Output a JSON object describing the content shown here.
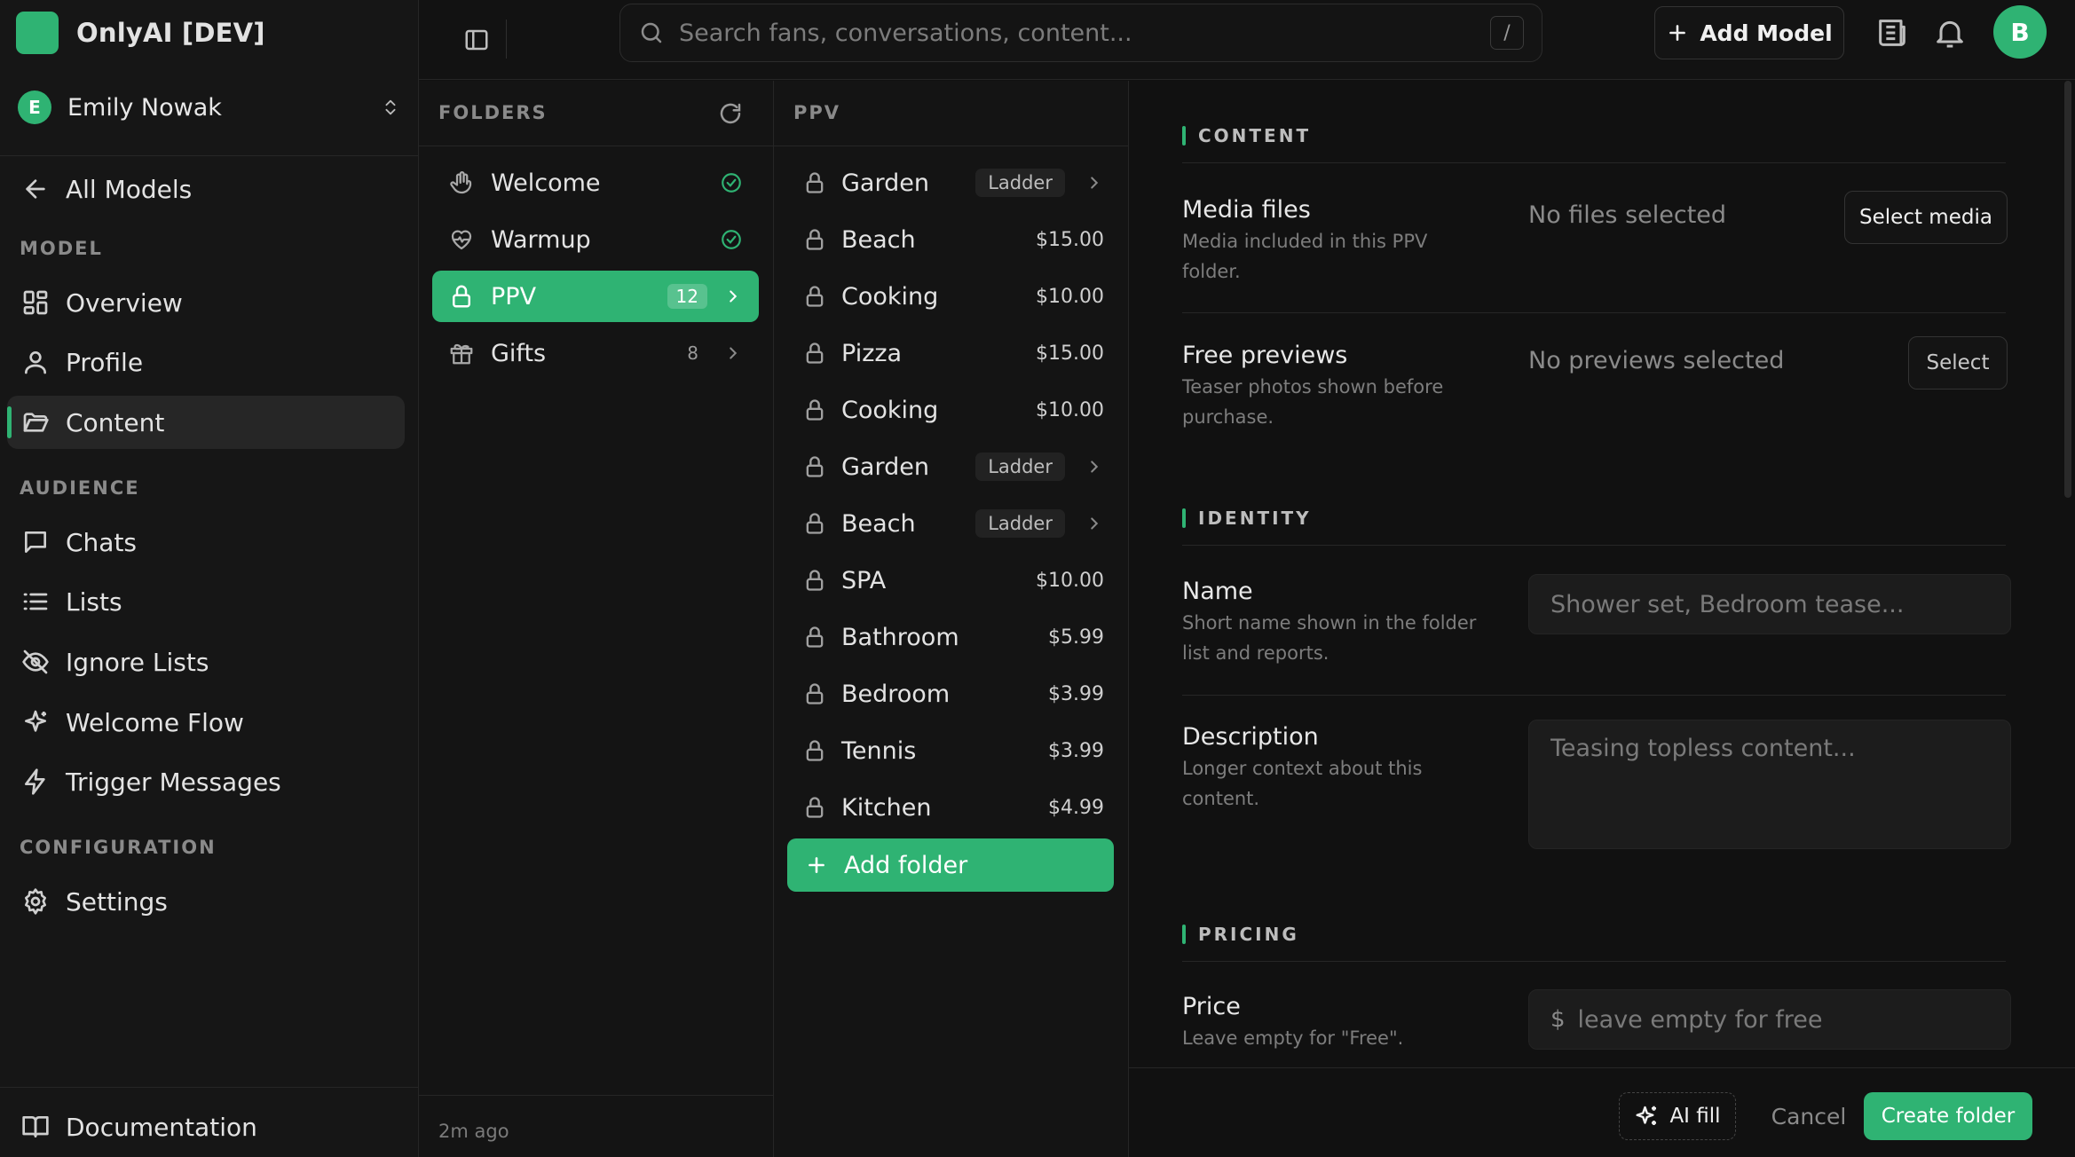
{
  "app": {
    "title": "OnlyAI [DEV]"
  },
  "account": {
    "initial": "E",
    "name": "Emily Nowak"
  },
  "nav": {
    "back_label": "All Models",
    "sections": {
      "model": "MODEL",
      "audience": "AUDIENCE",
      "configuration": "CONFIGURATION"
    },
    "items": {
      "overview": "Overview",
      "profile": "Profile",
      "content": "Content",
      "chats": "Chats",
      "lists": "Lists",
      "ignore_lists": "Ignore Lists",
      "welcome_flow": "Welcome Flow",
      "trigger_messages": "Trigger Messages",
      "settings": "Settings"
    },
    "active": "content",
    "documentation": "Documentation"
  },
  "topbar": {
    "search_placeholder": "Search fans, conversations, content...",
    "search_shortcut": "/",
    "add_model_label": "Add Model",
    "avatar_initial": "B"
  },
  "folders": {
    "header": "FOLDERS",
    "items": [
      {
        "label": "Welcome",
        "status": "done"
      },
      {
        "label": "Warmup",
        "status": "done"
      },
      {
        "label": "PPV",
        "count": "12",
        "active": true
      },
      {
        "label": "Gifts",
        "count": "8"
      }
    ],
    "updated": "2m ago"
  },
  "ppv": {
    "header": "PPV",
    "items": [
      {
        "label": "Garden",
        "tag": "Ladder"
      },
      {
        "label": "Beach",
        "price": "$15.00"
      },
      {
        "label": "Cooking",
        "price": "$10.00"
      },
      {
        "label": "Pizza",
        "price": "$15.00"
      },
      {
        "label": "Cooking",
        "price": "$10.00"
      },
      {
        "label": "Garden",
        "tag": "Ladder"
      },
      {
        "label": "Beach",
        "tag": "Ladder"
      },
      {
        "label": "SPA",
        "price": "$10.00"
      },
      {
        "label": "Bathroom",
        "price": "$5.99"
      },
      {
        "label": "Bedroom",
        "price": "$3.99"
      },
      {
        "label": "Tennis",
        "price": "$3.99"
      },
      {
        "label": "Kitchen",
        "price": "$4.99"
      }
    ],
    "add_label": "Add folder"
  },
  "details": {
    "content": {
      "title": "CONTENT",
      "media": {
        "label": "Media files",
        "help": "Media included in this PPV folder.",
        "value": "No files selected",
        "button": "Select media"
      },
      "previews": {
        "label": "Free previews",
        "help": "Teaser photos shown before purchase.",
        "value": "No previews selected",
        "button": "Select"
      }
    },
    "identity": {
      "title": "IDENTITY",
      "name": {
        "label": "Name",
        "help": "Short name shown in the folder list and reports.",
        "placeholder": "Shower set, Bedroom tease..."
      },
      "description": {
        "label": "Description",
        "help": "Longer context about this content.",
        "placeholder": "Teasing topless content..."
      }
    },
    "pricing": {
      "title": "PRICING",
      "price": {
        "label": "Price",
        "help": "Leave empty for \"Free\".",
        "currency": "$",
        "placeholder": "leave empty for free"
      }
    }
  },
  "footer": {
    "ai_fill": "AI fill",
    "cancel": "Cancel",
    "create": "Create folder"
  },
  "colors": {
    "accent": "#2fb373",
    "background": "#111111",
    "panel": "#141414"
  }
}
